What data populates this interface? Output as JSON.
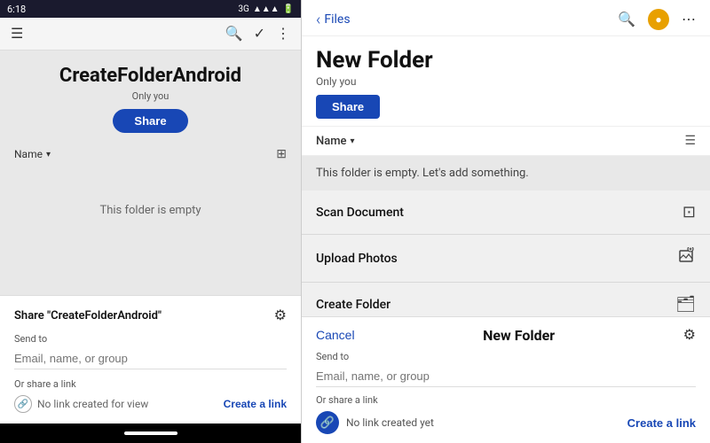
{
  "left": {
    "status_bar": {
      "time": "6:18",
      "signal": "3G",
      "icons": "📶🔋"
    },
    "toolbar": {
      "menu_icon": "☰",
      "search_icon": "🔍",
      "check_icon": "✓",
      "more_icon": "⋮"
    },
    "folder": {
      "title": "CreateFolderAndroid",
      "subtitle": "Only you",
      "share_label": "Share"
    },
    "name_sort": {
      "label": "Name",
      "chevron": "▾",
      "grid_icon": "⊞"
    },
    "empty_text": "This folder is empty",
    "share_panel": {
      "title": "Share \"CreateFolderAndroid\"",
      "gear_icon": "⚙",
      "send_to_label": "Send to",
      "email_placeholder": "Email, name, or group",
      "or_share_label": "Or share a link",
      "no_link_text": "No link created for view",
      "create_link_label": "Create a link"
    }
  },
  "right": {
    "header": {
      "back_label": "Files",
      "back_chevron": "‹",
      "search_icon": "🔍",
      "notif_icon": "🔔",
      "more_icon": "⋯"
    },
    "folder": {
      "title": "New Folder",
      "subtitle": "Only you",
      "share_label": "Share"
    },
    "name_sort": {
      "label": "Name",
      "chevron": "▾",
      "list_icon": "☰"
    },
    "empty_text": "This folder is empty. Let's add something.",
    "actions": [
      {
        "label": "Scan Document",
        "icon": "⊡"
      },
      {
        "label": "Upload Photos",
        "icon": "🖼"
      },
      {
        "label": "Create Folder",
        "icon": "🗂"
      }
    ],
    "share_panel": {
      "cancel_label": "Cancel",
      "title": "New Folder",
      "gear_icon": "⚙",
      "send_to_label": "Send to",
      "email_placeholder": "Email, name, or group",
      "or_share_label": "Or share a link",
      "no_link_text": "No link created yet",
      "create_link_label": "Create a link"
    }
  }
}
